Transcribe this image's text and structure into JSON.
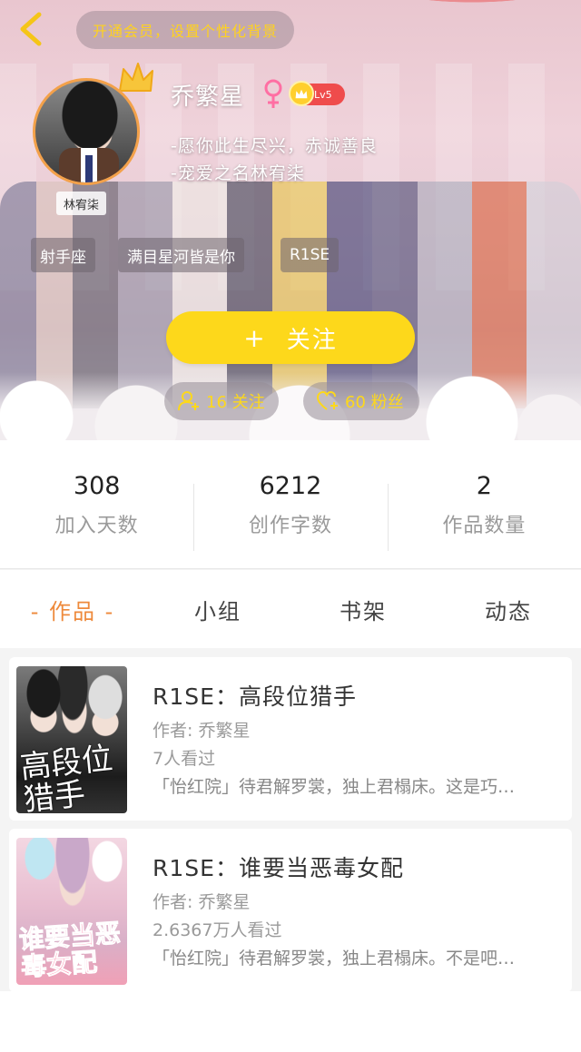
{
  "header": {
    "vip_banner": "开通会员，设置个性化背景"
  },
  "profile": {
    "avatar_name": "林宥柒",
    "username": "乔繁星",
    "gender_symbol": "♀",
    "level": "Lv5",
    "bio": [
      "-愿你此生尽兴，赤诚善良",
      "-宠爱之名林宥柒"
    ],
    "tags": [
      "射手座",
      "满目星河皆是你",
      "R1SE"
    ],
    "follow_button": "关注",
    "follow_plus": "+",
    "following": "16 关注",
    "fans": "60 粉丝"
  },
  "stats": [
    {
      "value": "308",
      "label": "加入天数"
    },
    {
      "value": "6212",
      "label": "创作字数"
    },
    {
      "value": "2",
      "label": "作品数量"
    }
  ],
  "tabs": [
    "- 作品 -",
    "小组",
    "书架",
    "动态"
  ],
  "works": [
    {
      "title": "R1SE：高段位猎手",
      "author": "作者: 乔繁星",
      "views": "7人看过",
      "desc": "「怡红院」待君解罗裳，独上君榻床。这是巧…",
      "cover_text": "高段位猎手"
    },
    {
      "title": "R1SE：谁要当恶毒女配",
      "author": "作者: 乔繁星",
      "views": "2.6367万人看过",
      "desc": "「怡红院」待君解罗裳，独上君榻床。不是吧…",
      "cover_text": "谁要当恶毒女配"
    }
  ],
  "colors": {
    "accent_yellow": "#fdd81b",
    "tab_active": "#ee8a3c",
    "level_badge": "#ef4c4c",
    "avatar_ring": "#f3a14a"
  }
}
